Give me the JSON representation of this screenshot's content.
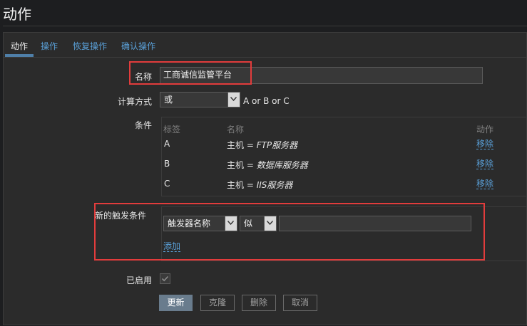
{
  "page": {
    "title": "动作"
  },
  "tabs": [
    {
      "label": "动作",
      "active": true
    },
    {
      "label": "操作",
      "active": false
    },
    {
      "label": "恢复操作",
      "active": false
    },
    {
      "label": "确认操作",
      "active": false
    }
  ],
  "form": {
    "name_label": "名称",
    "name_value": "工商诚信监管平台",
    "calc_label": "计算方式",
    "calc_value": "或",
    "calc_formula": "A or B or C",
    "conditions_label": "条件",
    "conditions_headers": {
      "label": "标签",
      "name": "名称",
      "action": "动作"
    },
    "conditions": [
      {
        "label": "A",
        "prefix": "主机 = ",
        "value": "FTP服务器",
        "action": "移除"
      },
      {
        "label": "B",
        "prefix": "主机 = ",
        "value": "数据库服务器",
        "action": "移除"
      },
      {
        "label": "C",
        "prefix": "主机 = ",
        "value": "IIS服务器",
        "action": "移除"
      }
    ],
    "new_condition_label": "新的触发条件",
    "new_condition_type": "触发器名称",
    "new_condition_operator": "似",
    "new_condition_value": "",
    "add_link": "添加",
    "enabled_label": "已启用",
    "enabled": true
  },
  "buttons": {
    "update": "更新",
    "clone": "克隆",
    "delete": "删除",
    "cancel": "取消"
  },
  "colors": {
    "background": "#1d1e20",
    "panel": "#2b2b2b",
    "link": "#5aa0d8",
    "highlight": "#e23c3c",
    "primary": "#697c8d"
  }
}
